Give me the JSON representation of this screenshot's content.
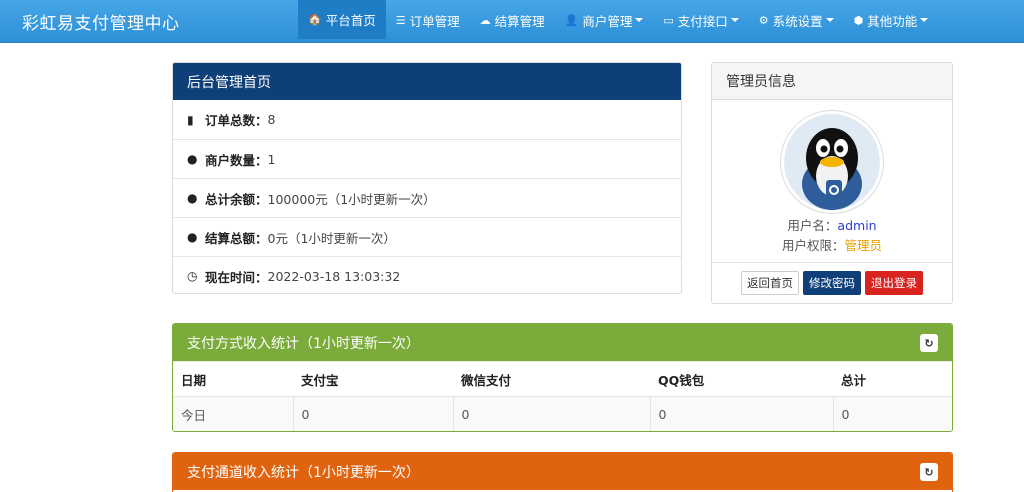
{
  "brand": "彩虹易支付管理中心",
  "nav": [
    {
      "icon": "home-icon",
      "glyph": "🏠",
      "label": "平台首页",
      "active": true
    },
    {
      "icon": "list-icon",
      "glyph": "☰",
      "label": "订单管理"
    },
    {
      "icon": "cloud-icon",
      "glyph": "☁",
      "label": "结算管理"
    },
    {
      "icon": "user-icon",
      "glyph": "👤",
      "label": "商户管理",
      "caret": true
    },
    {
      "icon": "card-icon",
      "glyph": "▭",
      "label": "支付接口",
      "caret": true
    },
    {
      "icon": "gear-icon",
      "glyph": "⚙",
      "label": "系统设置",
      "caret": true
    },
    {
      "icon": "cube-icon",
      "glyph": "⬢",
      "label": "其他功能",
      "caret": true
    }
  ],
  "main_panel": {
    "title": "后台管理首页",
    "stats": [
      {
        "icon": "bar-chart-icon",
        "glyph": "▮",
        "label": "订单总数：",
        "value": "8"
      },
      {
        "icon": "drop-icon",
        "glyph": "💧",
        "label": "商户数量：",
        "value": "1"
      },
      {
        "icon": "drop-icon",
        "glyph": "💧",
        "label": "总计余额：",
        "value": "100000元（1小时更新一次）"
      },
      {
        "icon": "drop-icon",
        "glyph": "💧",
        "label": "结算总额：",
        "value": "0元（1小时更新一次）"
      },
      {
        "icon": "clock-icon",
        "glyph": "🕒",
        "label": "现在时间：",
        "value": " 2022-03-18 13:03:32"
      }
    ]
  },
  "admin_panel": {
    "title": "管理员信息",
    "username_label": "用户名：",
    "username": "admin",
    "role_label": "用户权限：",
    "role": "管理员",
    "buttons": {
      "home": "返回首页",
      "change_pwd": "修改密码",
      "logout": "退出登录"
    }
  },
  "pay_method_panel": {
    "title": "支付方式收入统计（1小时更新一次）",
    "headers": [
      "日期",
      "支付宝",
      "微信支付",
      "QQ钱包",
      "总计"
    ],
    "rows": [
      [
        "今日",
        "0",
        "0",
        "0",
        "0"
      ]
    ]
  },
  "pay_channel_panel": {
    "title": "支付通道收入统计（1小时更新一次）"
  },
  "colors": {
    "nav": "#3a9be0",
    "blue_head": "#0f3f78",
    "green_head": "#7bab3a",
    "orange_head": "#e06410"
  }
}
